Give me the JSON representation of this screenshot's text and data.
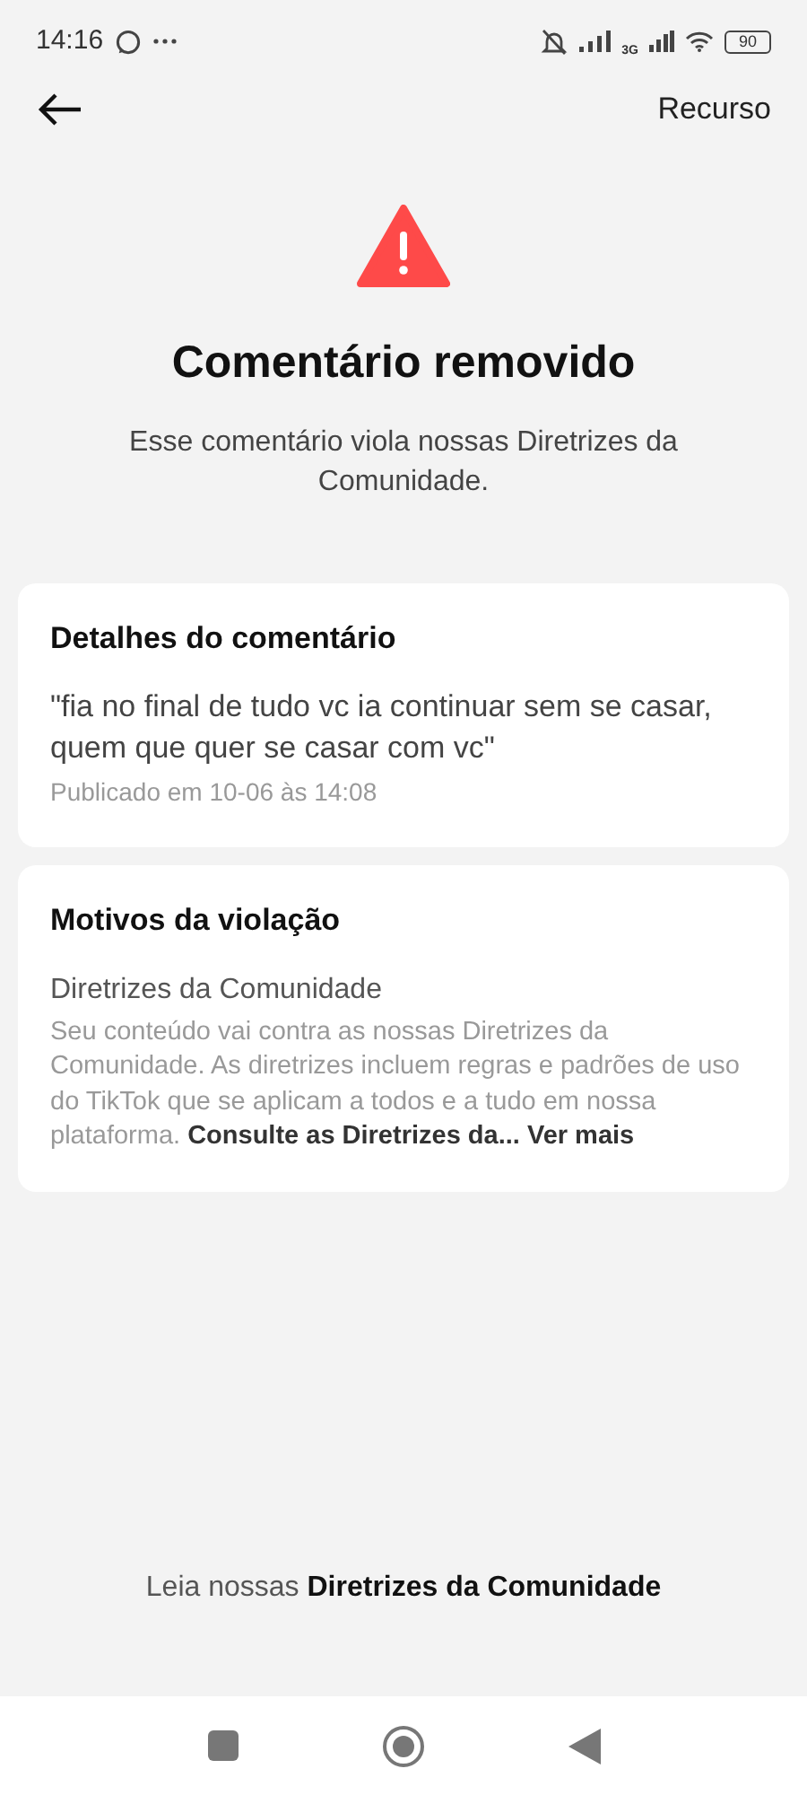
{
  "status_bar": {
    "time": "14:16",
    "network": "3G",
    "battery": "90"
  },
  "header": {
    "action": "Recurso"
  },
  "notice": {
    "title": "Comentário removido",
    "subtitle": "Esse comentário viola nossas Diretrizes da Comunidade."
  },
  "comment_card": {
    "title": "Detalhes do comentário",
    "comment": "\"fia no final de tudo vc ia continuar sem se casar, quem que quer se casar com vc\"",
    "posted": "Publicado em 10-06 às 14:08"
  },
  "violation_card": {
    "title": "Motivos da violação",
    "policy": "Diretrizes da Comunidade",
    "description": "Seu conteúdo vai contra as nossas Diretrizes da Comunidade. As diretrizes incluem regras e padrões de uso do TikTok que se aplicam a todos e a tudo em nossa plataforma. **Consulte as Diretrizes da... Ver mais**"
  },
  "footer": {
    "text": "Leia nossas **Diretrizes da Comunidade**"
  }
}
